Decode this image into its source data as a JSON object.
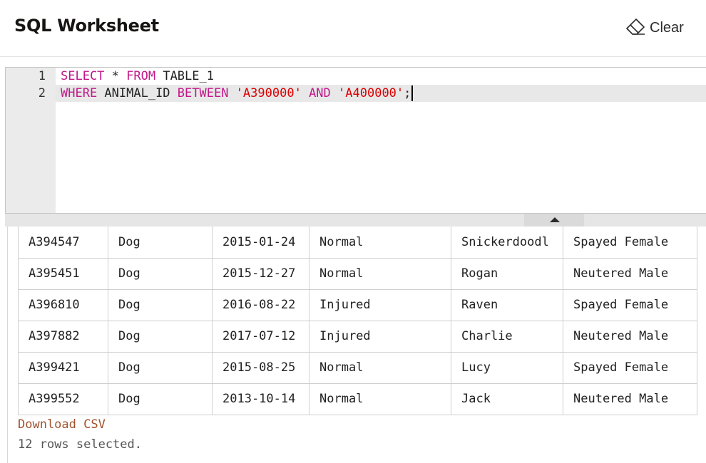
{
  "header": {
    "title": "SQL Worksheet",
    "clear_label": "Clear",
    "clear_icon": "eraser-icon"
  },
  "editor": {
    "line_numbers": [
      "1",
      "2"
    ],
    "lines": [
      [
        {
          "text": "SELECT",
          "type": "kw"
        },
        {
          "text": " * ",
          "type": "plain"
        },
        {
          "text": "FROM",
          "type": "kw"
        },
        {
          "text": " TABLE_1",
          "type": "plain"
        }
      ],
      [
        {
          "text": "WHERE",
          "type": "kw"
        },
        {
          "text": " ANIMAL_ID ",
          "type": "plain"
        },
        {
          "text": "BETWEEN",
          "type": "kw"
        },
        {
          "text": " ",
          "type": "plain"
        },
        {
          "text": "'A390000'",
          "type": "str"
        },
        {
          "text": " ",
          "type": "plain"
        },
        {
          "text": "AND",
          "type": "kw"
        },
        {
          "text": " ",
          "type": "plain"
        },
        {
          "text": "'A400000'",
          "type": "str"
        },
        {
          "text": ";",
          "type": "plain"
        }
      ]
    ],
    "colors": {
      "keyword": "#c1198a",
      "string": "#dd0000"
    }
  },
  "results": {
    "rows": [
      [
        "A394547",
        "Dog",
        "2015-01-24",
        "Normal",
        "Snickerdoodl",
        "Spayed Female"
      ],
      [
        "A395451",
        "Dog",
        "2015-12-27",
        "Normal",
        "Rogan",
        "Neutered Male"
      ],
      [
        "A396810",
        "Dog",
        "2016-08-22",
        "Injured",
        "Raven",
        "Spayed Female"
      ],
      [
        "A397882",
        "Dog",
        "2017-07-12",
        "Injured",
        "Charlie",
        "Neutered Male"
      ],
      [
        "A399421",
        "Dog",
        "2015-08-25",
        "Normal",
        "Lucy",
        "Spayed Female"
      ],
      [
        "A399552",
        "Dog",
        "2013-10-14",
        "Normal",
        "Jack",
        "Neutered Male"
      ]
    ],
    "download_label": "Download CSV",
    "rows_selected_text": "12 rows selected."
  }
}
